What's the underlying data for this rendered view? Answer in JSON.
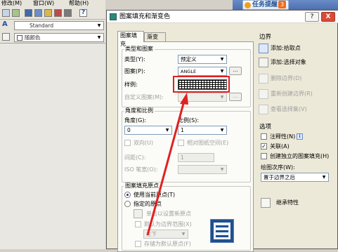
{
  "menubar": {
    "items": [
      "修改(M)",
      "窗口(W)",
      "帮助(H)"
    ]
  },
  "toolbar": {
    "text_style": "Standard",
    "color_combo": "随颜色"
  },
  "taskbar": {
    "badge": "任务提醒",
    "count": "3"
  },
  "dialog": {
    "title": "图案填充和渐变色",
    "help_button": "?",
    "close_button": "X",
    "tabs": [
      "图案填充",
      "渐变色"
    ],
    "type_pattern": {
      "group_title": "类型和图案",
      "type_label": "类型(Y):",
      "type_value": "预定义",
      "pattern_label": "图案(P):",
      "pattern_value": "ANGLE",
      "pattern_browse": "...",
      "sample_label": "样例:",
      "custom_label": "自定义图案(M):",
      "custom_browse": "..."
    },
    "angle_scale": {
      "group_title": "角度和比例",
      "angle_label": "角度(G):",
      "angle_value": "0",
      "scale_label": "比例(S):",
      "scale_value": "1",
      "double_label": "双向(U)",
      "relative_label": "相对图纸空间(E)",
      "spacing_label": "间距(C):",
      "spacing_value": "1",
      "iso_label": "ISO 笔宽(O):",
      "iso_value": ""
    },
    "origin": {
      "group_title": "图案填充原点",
      "use_current": "使用当前原点(T)",
      "specified": "指定的原点",
      "click_set": "单击以设置新原点",
      "default_boundary": "默认为边界范围(X)",
      "position_value": "左下",
      "store_default": "存储为默认原点(F)"
    },
    "boundary": {
      "title": "边界",
      "add_pick": "添加:拾取点",
      "add_select": "添加:选择对象",
      "remove": "删除边界(D)",
      "recreate": "重新创建边界(R)",
      "view_selection": "查看选择集(V)"
    },
    "options": {
      "title": "选项",
      "annotative": "注释性(N)",
      "associative": "关联(A)",
      "separate": "创建独立的图案填充(H)",
      "draw_order_label": "绘图次序(W):",
      "draw_order_value": "置于边界之后",
      "inherit": "继承特性"
    }
  }
}
